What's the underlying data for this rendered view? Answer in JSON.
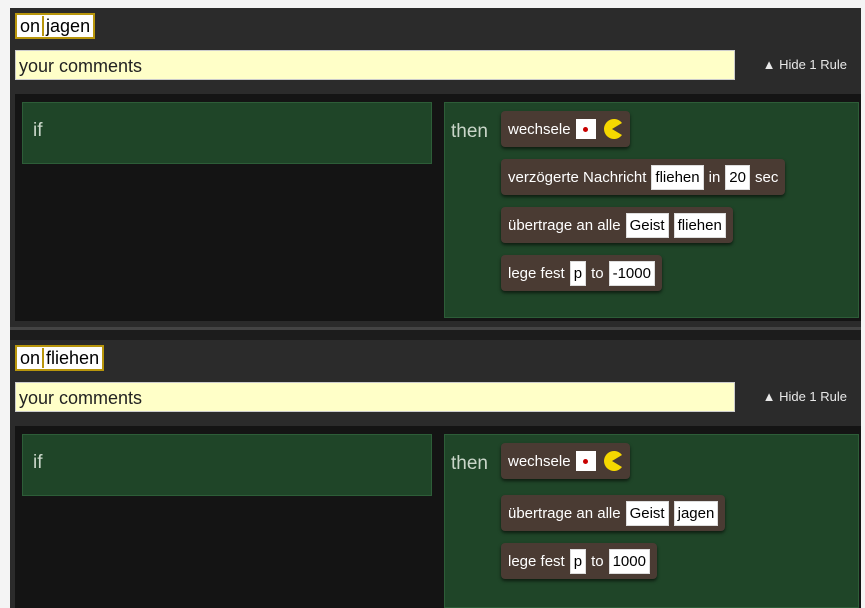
{
  "rules": [
    {
      "event_on": "on",
      "event_name": "jagen",
      "comment": "your comments",
      "hide_label": "▲ Hide 1 Rule",
      "if_label": "if",
      "then_label": "then",
      "actions": [
        {
          "verb": "wechsele"
        },
        {
          "verb": "verzögerte Nachricht",
          "message": "fliehen",
          "in": "in",
          "value": "20",
          "unit": "sec"
        },
        {
          "verb": "übertrage an alle",
          "target": "Geist",
          "message": "fliehen"
        },
        {
          "verb": "lege fest",
          "variable": "p",
          "to": "to",
          "value": "-1000"
        }
      ]
    },
    {
      "event_on": "on",
      "event_name": "fliehen",
      "comment": "your comments",
      "hide_label": "▲ Hide 1 Rule",
      "if_label": "if",
      "then_label": "then",
      "actions": [
        {
          "verb": "wechsele"
        },
        {
          "verb": "übertrage an alle",
          "target": "Geist",
          "message": "jagen"
        },
        {
          "verb": "lege fest",
          "variable": "p",
          "to": "to",
          "value": "1000"
        }
      ]
    }
  ],
  "icons": {
    "sprite_from": "red-dot-icon",
    "sprite_to": "pacman-icon"
  },
  "colors": {
    "panel": "#2b2b2b",
    "rule_green": "#1f4528",
    "action_brown": "#4a3b33",
    "event_border": "#b8960c",
    "comment_bg": "#ffffc8",
    "pacman": "#f5d800"
  }
}
